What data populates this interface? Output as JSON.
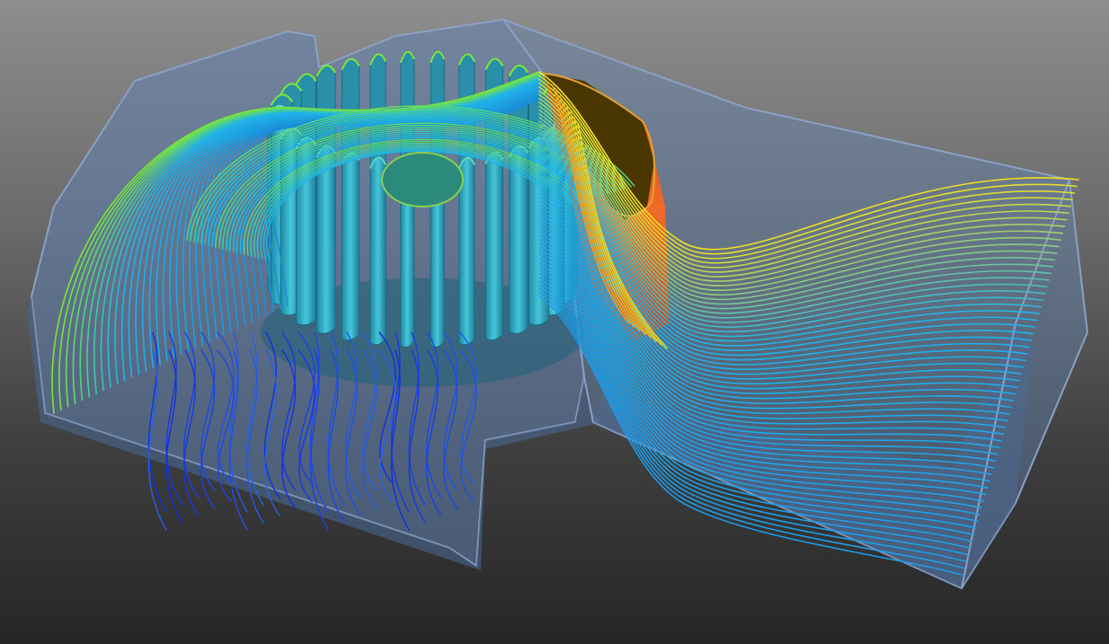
{
  "scene": {
    "subject": "fan-blower-flow-simulation",
    "colors": {
      "background_top": "#8e8e8e",
      "background_bottom": "#262626",
      "housing_fill": "#5f7fae",
      "housing_edge": "#7b93bb",
      "blade": "#38b6cc",
      "blade_shadow": "#1b6e86",
      "baffle_front": "#f05a20",
      "baffle_top": "#4a3600",
      "streamline_low": "#1030e8",
      "streamline_mid": "#20b4e8",
      "streamline_high": "#7ae836",
      "streamline_peak": "#f0e020"
    },
    "icons": [
      "fan-impeller-icon",
      "duct-housing-icon",
      "baffle-icon"
    ]
  }
}
